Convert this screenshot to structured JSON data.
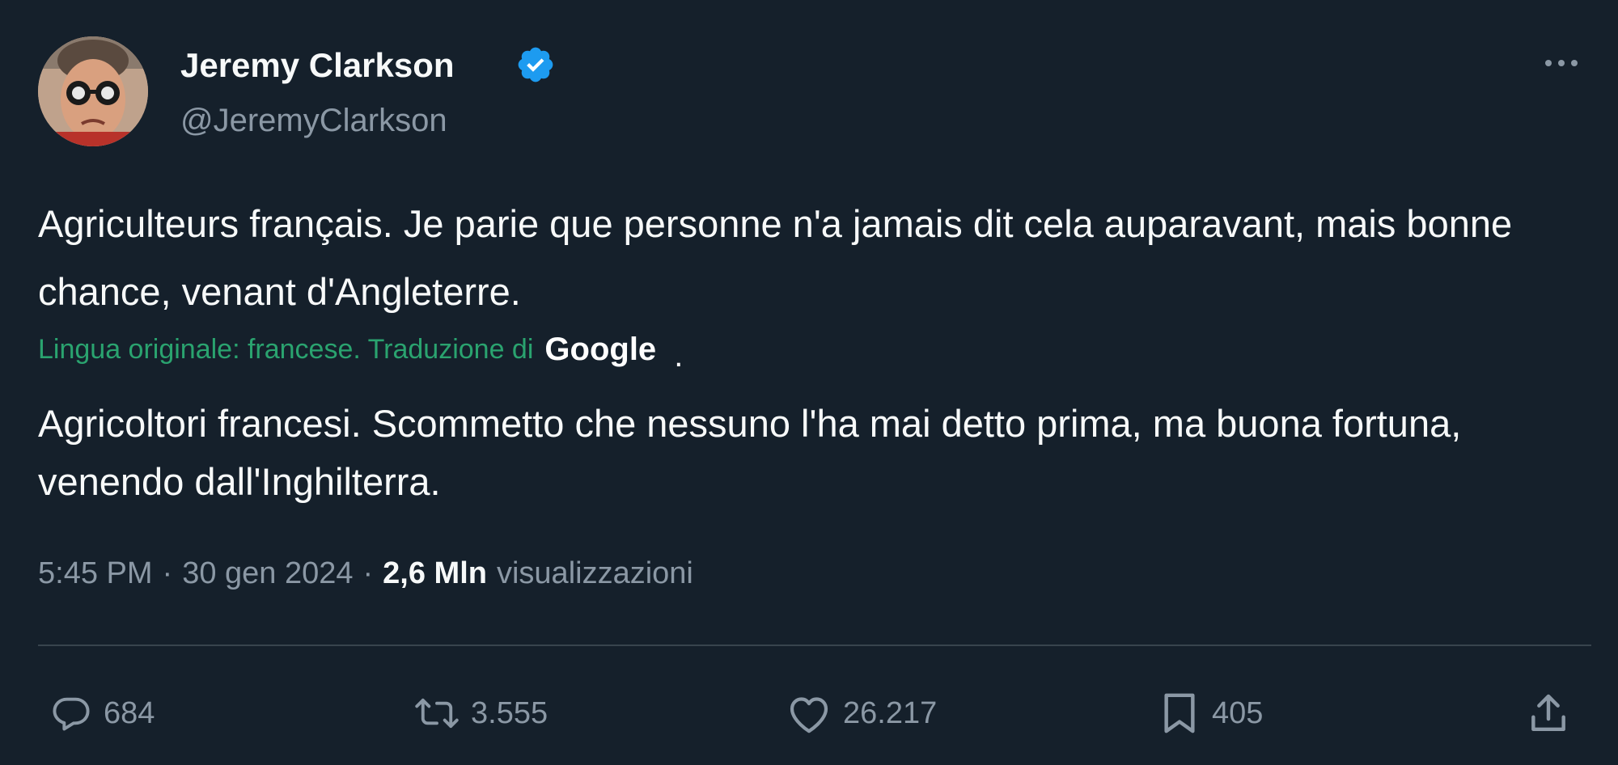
{
  "author": {
    "display_name": "Jeremy Clarkson",
    "handle": "@JeremyClarkson",
    "verified": true
  },
  "tweet": {
    "original_text": "Agriculteurs français. Je parie que personne n'a jamais dit cela auparavant, mais bonne chance, venant d'Angleterre.",
    "translation_label": "Lingua originale: francese. Traduzione di",
    "translation_provider": "Google",
    "translation_suffix": ".",
    "translated_text": "Agricoltori francesi. Scommetto che nessuno l'ha mai detto prima, ma buona fortuna, venendo dall'Inghilterra."
  },
  "meta": {
    "time": "5:45 PM",
    "separator": "·",
    "date": "30 gen 2024",
    "views_count": "2,6 Mln",
    "views_label": "visualizzazioni"
  },
  "actions": {
    "replies": "684",
    "reposts": "3.555",
    "likes": "26.217",
    "bookmarks": "405"
  },
  "icons": {
    "verified": "verified-badge-icon",
    "more": "more-options-icon",
    "reply": "reply-icon",
    "repost": "repost-icon",
    "like": "like-icon",
    "bookmark": "bookmark-icon",
    "share": "share-icon"
  },
  "colors": {
    "background": "#15202b",
    "text_primary": "#f7f9f9",
    "text_secondary": "#8b98a5",
    "verified_blue": "#1d9bf0",
    "translation_green": "#2aa36f",
    "divider": "#38444d"
  }
}
